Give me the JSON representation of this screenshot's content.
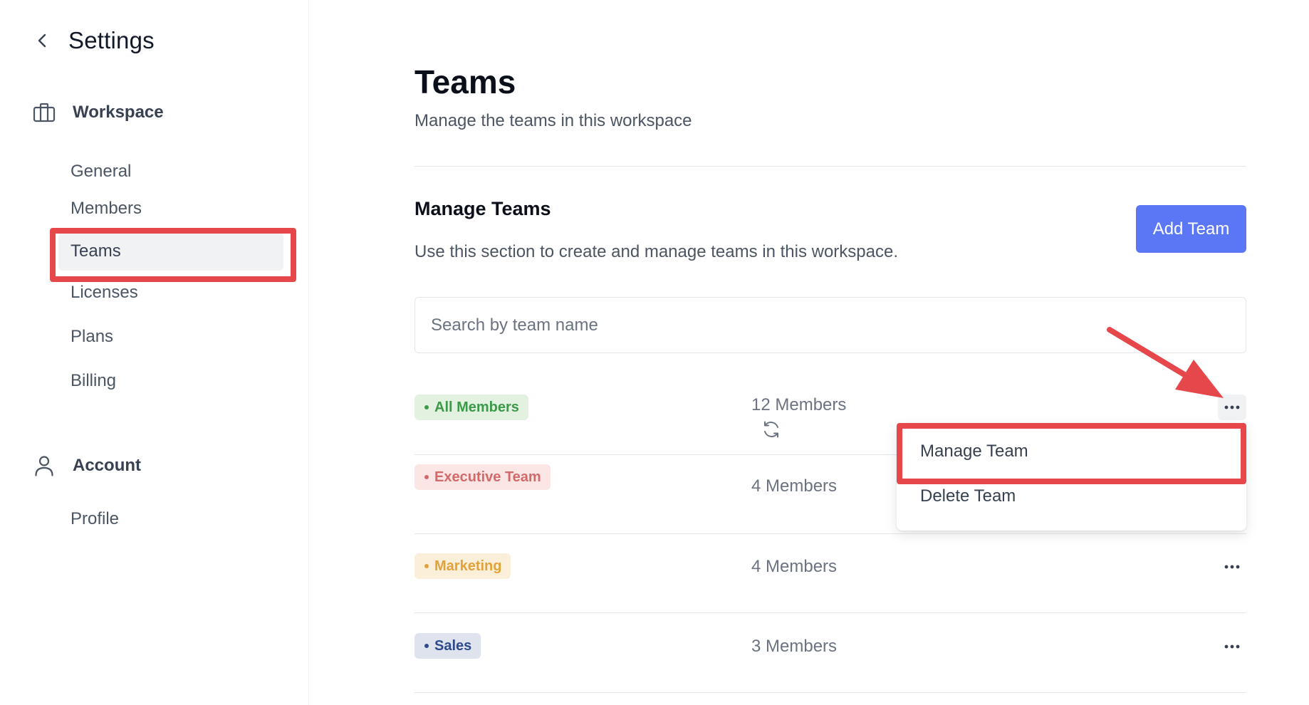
{
  "sidebar": {
    "title": "Settings",
    "sections": [
      {
        "label": "Workspace",
        "icon": "briefcase-icon",
        "items": [
          "General",
          "Members",
          "Teams",
          "Licenses",
          "Plans",
          "Billing"
        ]
      },
      {
        "label": "Account",
        "icon": "user-icon",
        "items": [
          "Profile"
        ]
      }
    ],
    "active_item": "Teams"
  },
  "main": {
    "title": "Teams",
    "subtitle": "Manage the teams in this workspace",
    "section_title": "Manage Teams",
    "section_subtitle": "Use this section to create and manage teams in this workspace.",
    "add_button": "Add Team",
    "search_placeholder": "Search by team name",
    "teams": [
      {
        "name": "All Members",
        "members": "12 Members",
        "bg": "#e3f1e1",
        "fg": "#3b9a49"
      },
      {
        "name": "Executive Team",
        "members": "4 Members",
        "bg": "#fbe5e5",
        "fg": "#d26a6a"
      },
      {
        "name": "Marketing",
        "members": "4 Members",
        "bg": "#fcefd9",
        "fg": "#e1a23a"
      },
      {
        "name": "Sales",
        "members": "3 Members",
        "bg": "#dfe3ee",
        "fg": "#2e4a8c"
      }
    ]
  },
  "dropdown": {
    "items": [
      "Manage Team",
      "Delete Team"
    ]
  },
  "colors": {
    "accent": "#5b77f5",
    "highlight": "#e5474b"
  }
}
